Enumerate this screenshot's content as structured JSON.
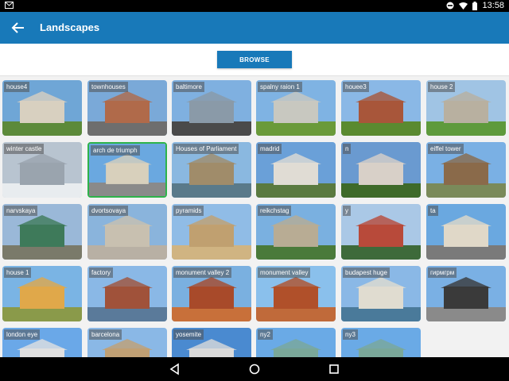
{
  "status_bar": {
    "time": "13:58"
  },
  "app_bar": {
    "title": "Landscapes"
  },
  "browse_label": "BROWSE",
  "tiles": [
    {
      "label": "house4",
      "sky": "#6fa6d6",
      "ground": "#5c8a3a",
      "subject": "#d8d0c0"
    },
    {
      "label": "townhouses",
      "sky": "#7aa9d8",
      "ground": "#6e6e6e",
      "subject": "#b06a4a"
    },
    {
      "label": "baltimore",
      "sky": "#7fb0e0",
      "ground": "#4a4a4a",
      "subject": "#8a9aa8"
    },
    {
      "label": "spalny raion 1",
      "sky": "#7fb3e3",
      "ground": "#6a9a3a",
      "subject": "#c8c8c0"
    },
    {
      "label": "houee3",
      "sky": "#8ab8e6",
      "ground": "#5a8a30",
      "subject": "#a8563a"
    },
    {
      "label": "house 2",
      "sky": "#a0c4e4",
      "ground": "#5e9a3c",
      "subject": "#b8b0a0"
    },
    {
      "label": "winter castle",
      "sky": "#b8c4d0",
      "ground": "#e8ecef",
      "subject": "#9aa4ae"
    },
    {
      "label": "arch de triumph",
      "sky": "#6aa8e0",
      "ground": "#8a8a8a",
      "subject": "#d8d0bc",
      "selected": true
    },
    {
      "label": "Houses of Parliament",
      "sky": "#8ab8e0",
      "ground": "#5a7a8a",
      "subject": "#a08c6a"
    },
    {
      "label": "madrid",
      "sky": "#6aa0d8",
      "ground": "#5a7a40",
      "subject": "#e0dcd4"
    },
    {
      "label": "n",
      "sky": "#6a9ad0",
      "ground": "#3e6a2a",
      "subject": "#d8d0c8"
    },
    {
      "label": "eiffel tower",
      "sky": "#7ab0e4",
      "ground": "#7a8a5a",
      "subject": "#8a6a4a"
    },
    {
      "label": "narvskaya",
      "sky": "#9ab8d8",
      "ground": "#7a7a6a",
      "subject": "#3e7a5a"
    },
    {
      "label": "dvortsovaya",
      "sky": "#8ab4dc",
      "ground": "#b8b0a4",
      "subject": "#c8c0b0"
    },
    {
      "label": "pyramids",
      "sky": "#90bce6",
      "ground": "#d0b482",
      "subject": "#c0a070"
    },
    {
      "label": "reikchstag",
      "sky": "#7ab0e0",
      "ground": "#4a7a3a",
      "subject": "#b8ac94"
    },
    {
      "label": "y",
      "sky": "#aac8e6",
      "ground": "#3e6a3a",
      "subject": "#b84a3a"
    },
    {
      "label": "ta",
      "sky": "#6aa8e0",
      "ground": "#7a7a7a",
      "subject": "#e0d8c8"
    },
    {
      "label": "house 1",
      "sky": "#7ab4e4",
      "ground": "#8a9a4a",
      "subject": "#e0a84a"
    },
    {
      "label": "factory",
      "sky": "#8ab8e6",
      "ground": "#5a7a9a",
      "subject": "#a0523a"
    },
    {
      "label": "monument valley 2",
      "sky": "#7ab0e0",
      "ground": "#c8703a",
      "subject": "#a84a2a"
    },
    {
      "label": "monument valley",
      "sky": "#8ac0ec",
      "ground": "#c06a3a",
      "subject": "#b0502a"
    },
    {
      "label": "budapest huge",
      "sky": "#8ab8e6",
      "ground": "#4a7a9a",
      "subject": "#e0dcd0"
    },
    {
      "label": "гирмгрм",
      "sky": "#7ab0e4",
      "ground": "#8a8a8a",
      "subject": "#3a3a3a"
    },
    {
      "label": "london eye",
      "sky": "#6aa8e8",
      "ground": "#4a6a8a",
      "subject": "#e0e0e0"
    },
    {
      "label": "barcelona",
      "sky": "#8ab8e6",
      "ground": "#8a7a5a",
      "subject": "#c0a074"
    },
    {
      "label": "yosemite",
      "sky": "#4a8ad0",
      "ground": "#6a7a6a",
      "subject": "#dadada"
    },
    {
      "label": "ny2",
      "sky": "#6aaae6",
      "ground": "#5a8aaa",
      "subject": "#7aa89a"
    },
    {
      "label": "ny3",
      "sky": "#6aaae6",
      "ground": "#5a8aaa",
      "subject": "#7aa89a"
    }
  ]
}
